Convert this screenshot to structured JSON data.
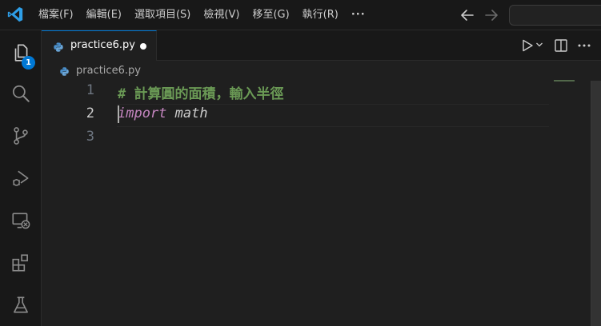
{
  "titlebar": {
    "menus": [
      "檔案(F)",
      "編輯(E)",
      "選取項目(S)",
      "檢視(V)",
      "移至(G)",
      "執行(R)"
    ],
    "more": "···"
  },
  "activitybar": {
    "items": [
      {
        "name": "explorer",
        "icon": "files-icon",
        "badge": "1"
      },
      {
        "name": "search",
        "icon": "search-icon"
      },
      {
        "name": "source-control",
        "icon": "source-control-icon"
      },
      {
        "name": "run-and-debug",
        "icon": "run-debug-icon"
      },
      {
        "name": "remote-explorer",
        "icon": "remote-explorer-icon"
      },
      {
        "name": "extensions",
        "icon": "extensions-icon"
      },
      {
        "name": "testing",
        "icon": "beaker-icon"
      }
    ]
  },
  "tabs": [
    {
      "label": "practice6.py",
      "icon": "python-icon",
      "dirty": true,
      "active": true
    }
  ],
  "breadcrumb": {
    "file": "practice6.py"
  },
  "editor": {
    "language": "python",
    "current_line": 2,
    "lines": [
      {
        "number": "1",
        "tokens": [
          {
            "type": "comment",
            "text": "# 計算圓的面積，輸入半徑"
          }
        ]
      },
      {
        "number": "2",
        "tokens": [
          {
            "type": "keyword",
            "text": "import"
          },
          {
            "type": "module",
            "text": " math"
          }
        ]
      },
      {
        "number": "3",
        "tokens": []
      }
    ]
  },
  "colors": {
    "accent": "#0078d4",
    "comment": "#6a9955",
    "keyword": "#c586c0",
    "editor_bg": "#1f1f1f",
    "chrome_bg": "#181818"
  }
}
